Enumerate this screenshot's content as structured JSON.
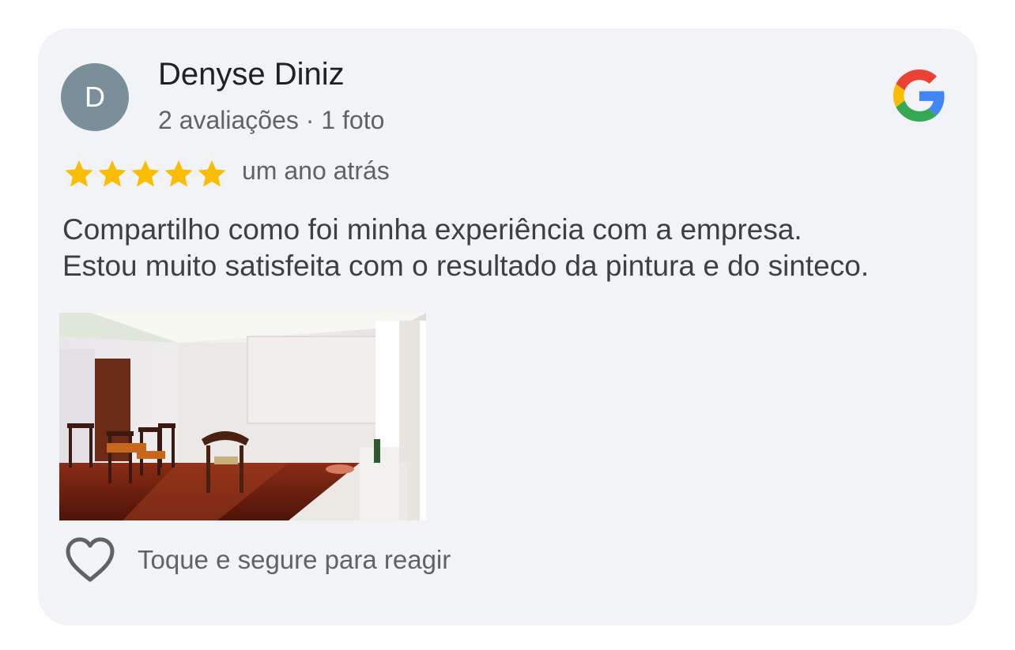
{
  "review": {
    "author": {
      "initial": "D",
      "name": "Denyse Diniz",
      "meta": "2 avaliações · 1 foto",
      "avatar_color": "#7b8f9b"
    },
    "source_icon": "google-logo-icon",
    "rating": 5,
    "rating_max": 5,
    "star_color": "#fbbc04",
    "time_ago": "um ano atrás",
    "text_lines": [
      "Compartilho como foi minha experiência com a empresa.",
      "Estou muito satisfeita com o resultado da pintura e do sinteco."
    ],
    "photo": {
      "description_icon": "living-room-photo"
    },
    "reaction": {
      "icon": "heart-icon",
      "label": "Toque e segure para reagir"
    }
  }
}
